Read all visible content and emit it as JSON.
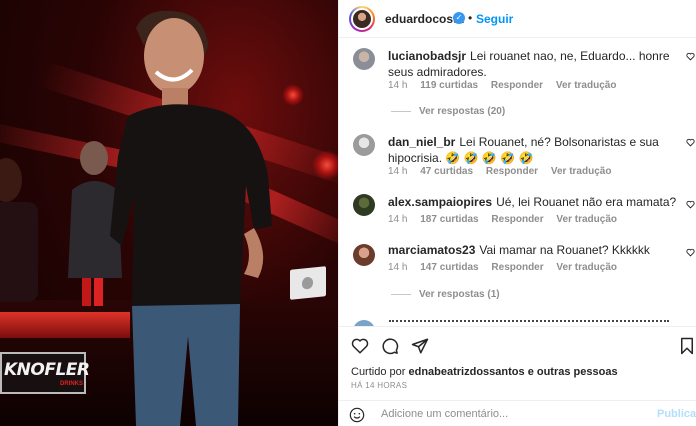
{
  "post": {
    "username": "eduardocosta",
    "follow_label": "Seguir",
    "separator": "•"
  },
  "photo": {
    "brand_logo": "KNOFLER",
    "brand_logo_sub": "DRINKS"
  },
  "comments": [
    {
      "user": "lucianobadsjr",
      "text": "Lei rouanet nao, ne, Eduardo... honre seus admiradores.",
      "time": "14 h",
      "likes": "119 curtidas",
      "reply": "Responder",
      "translate": "Ver tradução",
      "replies": "Ver respostas (20)"
    },
    {
      "user": "dan_niel_br",
      "text": "Lei Rouanet, né? Bolsonaristas e sua hipocrisia. 🤣 🤣 🤣 🤣 🤣",
      "time": "14 h",
      "likes": "47 curtidas",
      "reply": "Responder",
      "translate": "Ver tradução"
    },
    {
      "user": "alex.sampaiopires",
      "text": "Ué, lei Rouanet não era mamata?",
      "time": "14 h",
      "likes": "187 curtidas",
      "reply": "Responder",
      "translate": "Ver tradução"
    },
    {
      "user": "marciamatos23",
      "text": "Vai mamar na Rouanet? Kkkkkk",
      "time": "14 h",
      "likes": "147 curtidas",
      "reply": "Responder",
      "translate": "Ver tradução",
      "replies": "Ver respostas (1)"
    }
  ],
  "likes_line": {
    "prefix": "Curtido por",
    "user": "ednabeatrizdossantos",
    "suffix": "e outras pessoas"
  },
  "posted_time": "HÁ 14 HORAS",
  "add_comment": {
    "placeholder": "Adicione um comentário...",
    "publish_label": "Publicar"
  },
  "colors": {
    "accent": "#0095f6",
    "verified": "#3897f0",
    "muted": "#8e8e8e",
    "publish_disabled": "#b2dffc"
  }
}
